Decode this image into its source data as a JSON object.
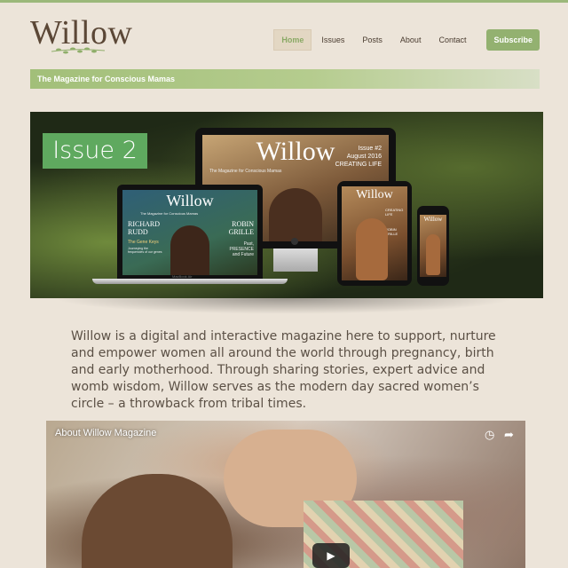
{
  "logo": {
    "text": "Willow"
  },
  "nav": {
    "items": [
      {
        "label": "Home",
        "active": true
      },
      {
        "label": "Issues",
        "active": false
      },
      {
        "label": "Posts",
        "active": false
      },
      {
        "label": "About",
        "active": false
      },
      {
        "label": "Contact",
        "active": false
      }
    ],
    "subscribe_label": "Subscribe"
  },
  "tagline": "The Magazine for Conscious Mamas",
  "hero": {
    "issue_label": "Issue 2",
    "devices": {
      "desktop": {
        "title": "Willow",
        "subtitle": "The Magazine for Conscious Mamas",
        "issue": "Issue #2",
        "date": "August 2016",
        "headline": "CREATING LIFE"
      },
      "laptop": {
        "title": "Willow",
        "subtitle": "The Magazine for Conscious Mamas",
        "left_name": "RICHARD RUDD",
        "left_sub": "The Gene Keys",
        "left_sub2": "Journeying the frequencies of our genes",
        "right_name": "ROBIN GRILLE",
        "right_sub": "Past, PRESENCE and Future",
        "brand": "MacBook Air"
      },
      "tablet": {
        "title": "Willow",
        "side1": "CREATING LIFE",
        "side2": "ROBIN GRILLE"
      },
      "phone": {
        "title": "Willow"
      }
    }
  },
  "intro_text": "Willow is a digital and interactive magazine here to support, nurture and empower women all around the world through pregnancy, birth and early motherhood. Through sharing stories, expert advice and womb wisdom, Willow serves as the modern day sacred women’s circle – a throwback from tribal times.",
  "video": {
    "title": "About Willow Magazine",
    "icons": [
      "clock-icon",
      "share-icon",
      "play-icon"
    ]
  },
  "colors": {
    "accent_green": "#93b170",
    "badge_green": "#5fa95f",
    "background": "#ece4d9",
    "text_brown": "#5b5045"
  }
}
